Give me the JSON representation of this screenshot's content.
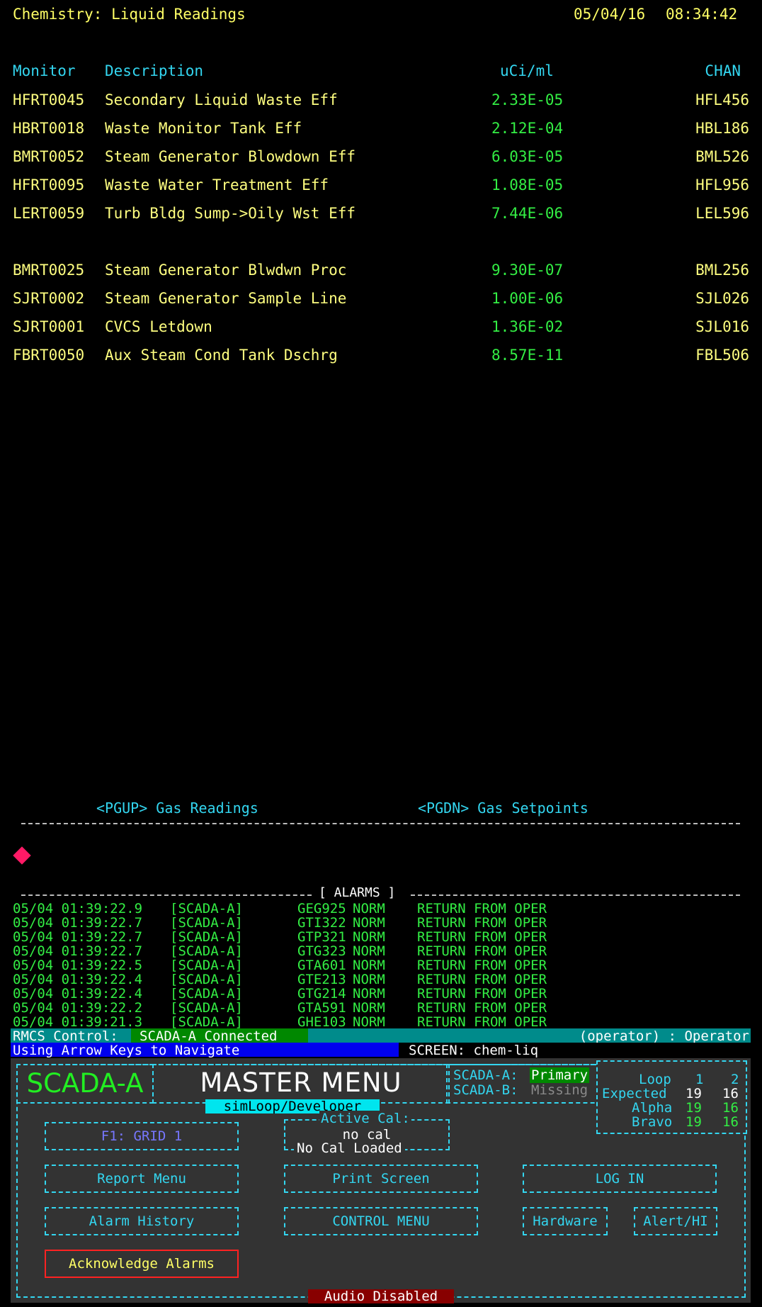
{
  "header": {
    "title": "Chemistry: Liquid Readings",
    "date": "05/04/16",
    "time": "08:34:42"
  },
  "columns": {
    "monitor": "Monitor",
    "description": "Description",
    "units": "uCi/ml",
    "chan": "CHAN"
  },
  "readings_group1": [
    {
      "monitor": "HFRT0045",
      "description": "Secondary Liquid Waste Eff",
      "value": "2.33E-05",
      "chan": "HFL456"
    },
    {
      "monitor": "HBRT0018",
      "description": "Waste Monitor Tank Eff",
      "value": "2.12E-04",
      "chan": "HBL186"
    },
    {
      "monitor": "BMRT0052",
      "description": "Steam Generator Blowdown Eff",
      "value": "6.03E-05",
      "chan": "BML526"
    },
    {
      "monitor": "HFRT0095",
      "description": "Waste Water Treatment Eff",
      "value": "1.08E-05",
      "chan": "HFL956"
    },
    {
      "monitor": "LERT0059",
      "description": "Turb Bldg Sump->Oily Wst Eff",
      "value": "7.44E-06",
      "chan": "LEL596"
    }
  ],
  "readings_group2": [
    {
      "monitor": "BMRT0025",
      "description": "Steam Generator Blwdwn Proc",
      "value": "9.30E-07",
      "chan": "BML256"
    },
    {
      "monitor": "SJRT0002",
      "description": "Steam Generator Sample Line",
      "value": "1.00E-06",
      "chan": "SJL026"
    },
    {
      "monitor": "SJRT0001",
      "description": "CVCS Letdown",
      "value": "1.36E-02",
      "chan": "SJL016"
    },
    {
      "monitor": "FBRT0050",
      "description": "Aux Steam Cond Tank Dschrg",
      "value": "8.57E-11",
      "chan": "FBL506"
    }
  ],
  "nav": {
    "pgup_key": "<PGUP>",
    "pgup_label": "Gas Readings",
    "pgdn_key": "<PGDN>",
    "pgdn_label": "Gas Setpoints"
  },
  "alarms": {
    "title": "[ ALARMS ]",
    "rows": [
      {
        "datetime": "05/04 01:39:22.9",
        "source": "[SCADA-A]",
        "chan": "GEG925",
        "state": "NORM",
        "message": "RETURN FROM OPER"
      },
      {
        "datetime": "05/04 01:39:22.7",
        "source": "[SCADA-A]",
        "chan": "GTI322",
        "state": "NORM",
        "message": "RETURN FROM OPER"
      },
      {
        "datetime": "05/04 01:39:22.7",
        "source": "[SCADA-A]",
        "chan": "GTP321",
        "state": "NORM",
        "message": "RETURN FROM OPER"
      },
      {
        "datetime": "05/04 01:39:22.7",
        "source": "[SCADA-A]",
        "chan": "GTG323",
        "state": "NORM",
        "message": "RETURN FROM OPER"
      },
      {
        "datetime": "05/04 01:39:22.5",
        "source": "[SCADA-A]",
        "chan": "GTA601",
        "state": "NORM",
        "message": "RETURN FROM OPER"
      },
      {
        "datetime": "05/04 01:39:22.4",
        "source": "[SCADA-A]",
        "chan": "GTE213",
        "state": "NORM",
        "message": "RETURN FROM OPER"
      },
      {
        "datetime": "05/04 01:39:22.4",
        "source": "[SCADA-A]",
        "chan": "GTG214",
        "state": "NORM",
        "message": "RETURN FROM OPER"
      },
      {
        "datetime": "05/04 01:39:22.2",
        "source": "[SCADA-A]",
        "chan": "GTA591",
        "state": "NORM",
        "message": "RETURN FROM OPER"
      },
      {
        "datetime": "05/04 01:39:21.3",
        "source": "[SCADA-A]",
        "chan": "GHE103",
        "state": "NORM",
        "message": "RETURN FROM OPER"
      }
    ]
  },
  "status": {
    "rmcs_label": "RMCS Control:",
    "rmcs_status": "SCADA-A Connected",
    "user": "(operator) : Operator",
    "nav_hint": "Using Arrow Keys to Navigate",
    "screen": "SCREEN: chem-liq"
  },
  "menu": {
    "brand": "SCADA-A",
    "title": "MASTER MENU",
    "submode": "simLoop/Developer",
    "scada_a_label": "SCADA-A:",
    "scada_a_state": "Primary",
    "scada_b_label": "SCADA-B:",
    "scada_b_state": "Missing",
    "loop": {
      "label": "Loop",
      "col1": "1",
      "col2": "2",
      "expected_label": "Expected",
      "expected_1": "19",
      "expected_2": "16",
      "alpha_label": "Alpha",
      "alpha_1": "19",
      "alpha_2": "16",
      "bravo_label": "Bravo",
      "bravo_1": "19",
      "bravo_2": "16"
    },
    "active_cal_title": "Active Cal:",
    "active_cal_value": "no cal",
    "active_cal_loaded": "No Cal Loaded",
    "buttons": {
      "f1": "F1:   GRID 1",
      "report": "Report  Menu",
      "print": "Print Screen",
      "login": "LOG IN",
      "history": "Alarm  History",
      "control": "CONTROL MENU",
      "hardware": "Hardware",
      "alert": "Alert/HI",
      "ack": "Acknowledge Alarms"
    },
    "audio": "Audio Disabled"
  },
  "colors": {
    "background": "#000000",
    "text_yellow": "#ffff80",
    "text_cyan": "#33d6f0",
    "value_green": "#33ee44",
    "panel_grey": "#333333",
    "status_teal": "#008b8b",
    "nav_blue": "#0000ee",
    "audio_red": "#880000",
    "diamond_pink": "#ff1a66"
  }
}
